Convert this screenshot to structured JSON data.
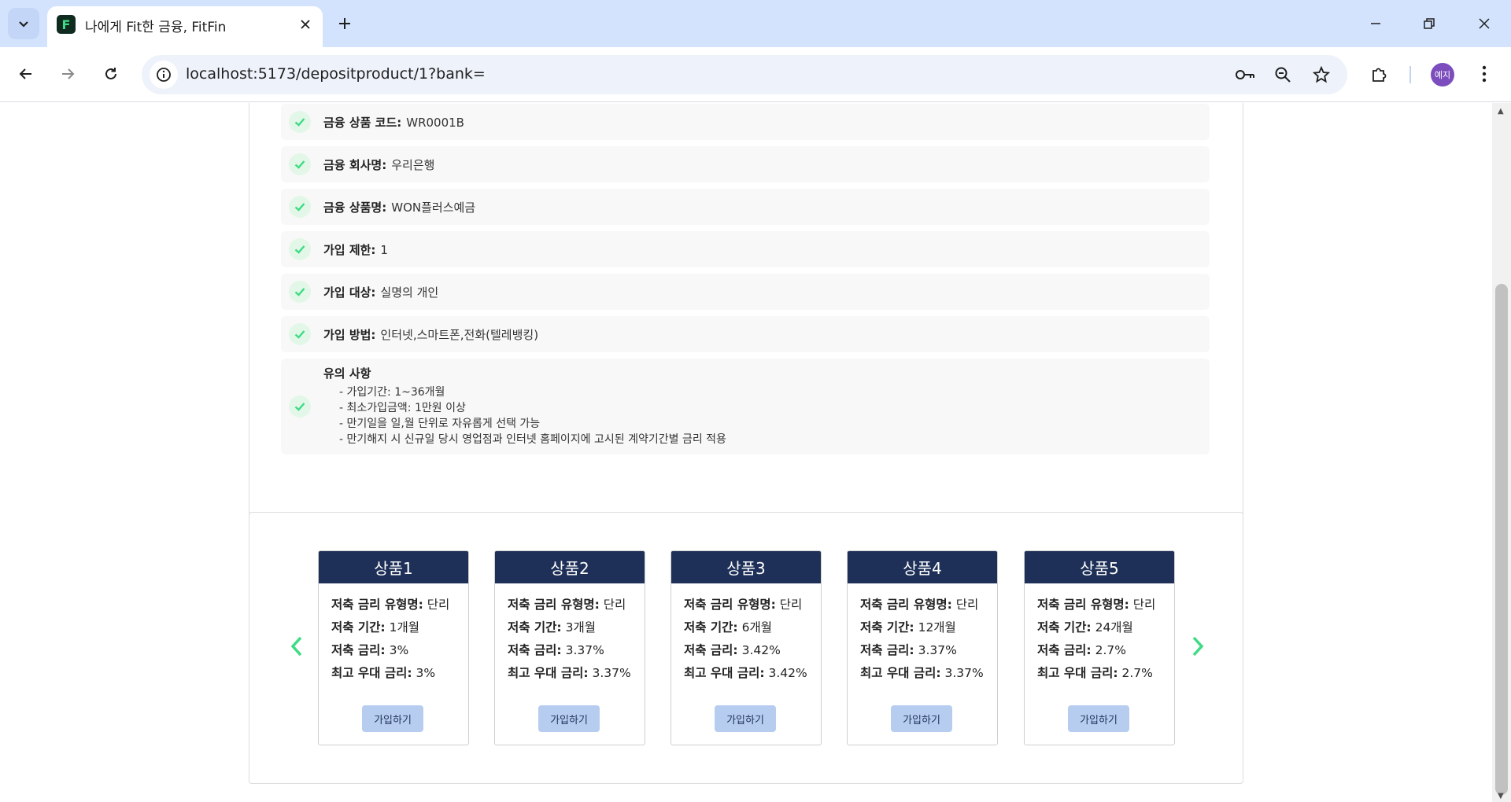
{
  "browser": {
    "tab_title": "나에게 Fit한 금융, FitFin",
    "favicon_letter": "F",
    "url": "localhost:5173/depositproduct/1?bank=",
    "profile_label": "예지"
  },
  "info": {
    "rows": [
      {
        "label": "금융 상품 코드:",
        "value": "WR0001B"
      },
      {
        "label": "금융 회사명:",
        "value": "우리은행"
      },
      {
        "label": "금융 상품명:",
        "value": "WON플러스예금"
      },
      {
        "label": "가입 제한:",
        "value": "1"
      },
      {
        "label": "가입 대상:",
        "value": "실명의 개인"
      },
      {
        "label": "가입 방법:",
        "value": "인터넷,스마트폰,전화(텔레뱅킹)"
      }
    ],
    "notes_title": "유의 사항",
    "notes": [
      "- 가입기간: 1~36개월",
      "- 최소가입금액: 1만원 이상",
      "- 만기일을 일,월 단위로 자유롭게 선택 가능",
      "- 만기해지 시 신규일 당시 영업점과 인터넷 홈페이지에 고시된 계약기간별 금리 적용"
    ]
  },
  "labels": {
    "rate_type": "저축 금리 유형명:",
    "term": "저축 기간:",
    "rate": "저축 금리:",
    "max_rate": "최고 우대 금리:"
  },
  "products": [
    {
      "name": "상품1",
      "rate_type": "단리",
      "term": "1개월",
      "rate": "3%",
      "max_rate": "3%",
      "button": "가입하기"
    },
    {
      "name": "상품2",
      "rate_type": "단리",
      "term": "3개월",
      "rate": "3.37%",
      "max_rate": "3.37%",
      "button": "가입하기"
    },
    {
      "name": "상품3",
      "rate_type": "단리",
      "term": "6개월",
      "rate": "3.42%",
      "max_rate": "3.42%",
      "button": "가입하기"
    },
    {
      "name": "상품4",
      "rate_type": "단리",
      "term": "12개월",
      "rate": "3.37%",
      "max_rate": "3.37%",
      "button": "가입하기"
    },
    {
      "name": "상품5",
      "rate_type": "단리",
      "term": "24개월",
      "rate": "2.7%",
      "max_rate": "2.7%",
      "button": "가입하기"
    }
  ],
  "colors": {
    "accent_green": "#3ddc84",
    "header_navy": "#1e3058",
    "button_blue": "#b7cdf0"
  }
}
